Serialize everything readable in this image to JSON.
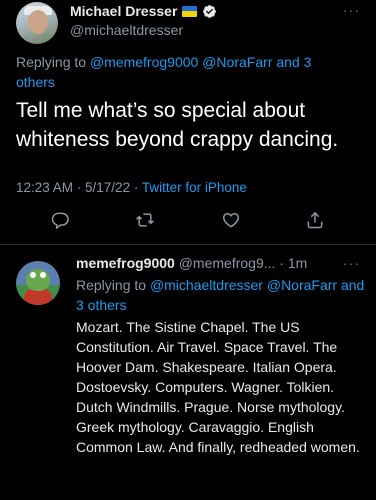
{
  "main_tweet": {
    "author": {
      "name": "Michael Dresser",
      "handle": "@michaeltdresser",
      "flag_icon": "ukraine-flag-icon",
      "verified_icon": "verified-badge-icon"
    },
    "replying_label": "Replying to",
    "replying_mentions": "@memefrog9000 @NoraFarr",
    "replying_others": "and 3 others",
    "text": "Tell me what’s so special about whiteness beyond crappy dancing.",
    "time": "12:23 AM · 5/17/22 ·",
    "source": "Twitter for iPhone",
    "more": "···",
    "actions": [
      "reply-icon",
      "retweet-icon",
      "like-icon",
      "share-icon"
    ]
  },
  "reply_tweet": {
    "author": {
      "name": "memefrog9000",
      "handle_time": "@memefrog9... · 1m"
    },
    "replying_label": "Replying to",
    "replying_mentions": "@michaeltdresser @NoraFarr",
    "replying_others": "and 3 others",
    "text": "Mozart. The Sistine Chapel. The US Constitution. Air Travel. Space Travel. The Hoover Dam. Shakespeare. Italian Opera. Dostoevsky. Computers. Wagner. Tolkien. Dutch Windmills. Prague. Norse mythology. Greek mythology. Caravaggio. English Common Law. And finally, redheaded women.",
    "more": "···"
  },
  "colors": {
    "background": "#000000",
    "text": "#e7e9ea",
    "secondary": "#8b98a5",
    "accent": "#1d9bf0",
    "divider": "#2f3336"
  }
}
